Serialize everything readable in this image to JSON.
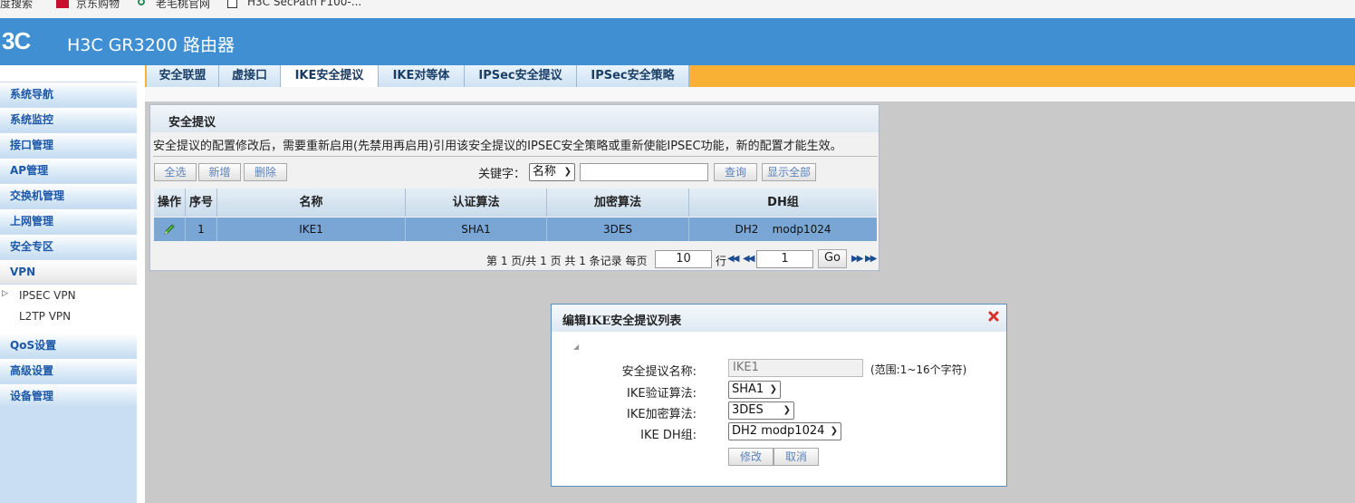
{
  "bookmarks": [
    "百度搜索",
    "京东购物",
    "老毛桃官网",
    "H3C SecPath F100-..."
  ],
  "header": {
    "logo": "3C",
    "title": "H3C GR3200 路由器"
  },
  "sidebar": {
    "items": [
      "系统导航",
      "系统监控",
      "接口管理",
      "AP管理",
      "交换机管理",
      "上网管理",
      "安全专区",
      "VPN"
    ],
    "vpn_sub": [
      "IPSEC VPN",
      "L2TP VPN"
    ],
    "items_after": [
      "QoS设置",
      "高级设置",
      "设备管理"
    ]
  },
  "tabs": [
    "安全联盟",
    "虚接口",
    "IKE安全提议",
    "IKE对等体",
    "IPSec安全提议",
    "IPSec安全策略"
  ],
  "active_tab": "IKE安全提议",
  "panel": {
    "title": "安全提议",
    "notice": "安全提议的配置修改后，需要重新启用(先禁用再启用)引用该安全提议的IPSEC安全策略或重新使能IPSEC功能，新的配置才能生效。",
    "buttons": {
      "select_all": "全选",
      "add": "新增",
      "delete": "删除",
      "query": "查询",
      "show_all": "显示全部"
    },
    "keyword_label": "关键字：",
    "keyword_field": "名称",
    "keyword_value": ""
  },
  "table": {
    "headers": [
      "操作",
      "序号",
      "名称",
      "认证算法",
      "加密算法",
      "DH组"
    ],
    "rows": [
      {
        "index": "1",
        "name": "IKE1",
        "auth": "SHA1",
        "enc": "3DES",
        "dh": "DH2    modp1024"
      }
    ]
  },
  "pager": {
    "summary": "第 1 页/共 1 页 共 1 条记录 每页",
    "per_page": "10",
    "row_label": "行",
    "page": "1",
    "go": "Go"
  },
  "dialog": {
    "title": "编辑IKE安全提议列表",
    "fields": {
      "name_label": "安全提议名称:",
      "name_value": "IKE1",
      "name_hint": "(范围:1~16个字符)",
      "auth_label": "IKE验证算法:",
      "auth_value": "SHA1",
      "enc_label": "IKE加密算法:",
      "enc_value": "3DES",
      "dh_label": "IKE DH组:",
      "dh_value": "DH2 modp1024"
    },
    "buttons": {
      "modify": "修改",
      "cancel": "取消"
    }
  },
  "colors": {
    "header": "#3f8fd2",
    "tabbar": "#f8b135",
    "selected_row": "#7aa6d6",
    "close": "#d9302a"
  }
}
